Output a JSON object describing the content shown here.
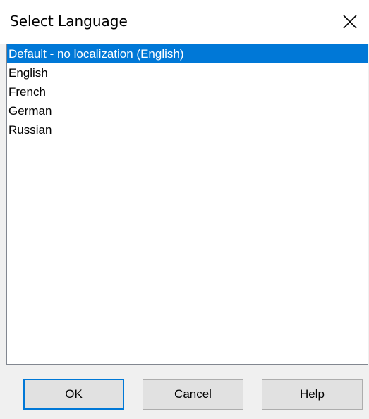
{
  "dialog": {
    "title": "Select Language",
    "close_icon": "close-icon"
  },
  "languages": {
    "items": [
      "Default - no localization (English)",
      "English",
      "French",
      "German",
      "Russian"
    ],
    "selected_index": 0
  },
  "buttons": {
    "ok": {
      "mnemonic": "O",
      "rest": "K"
    },
    "cancel": {
      "mnemonic": "C",
      "rest": "ancel"
    },
    "help": {
      "mnemonic": "H",
      "rest": "elp"
    }
  },
  "colors": {
    "selection": "#0078d7",
    "selection_text": "#ffffff",
    "dialog_bg": "#f0f0f0",
    "button_face": "#e1e1e1"
  }
}
